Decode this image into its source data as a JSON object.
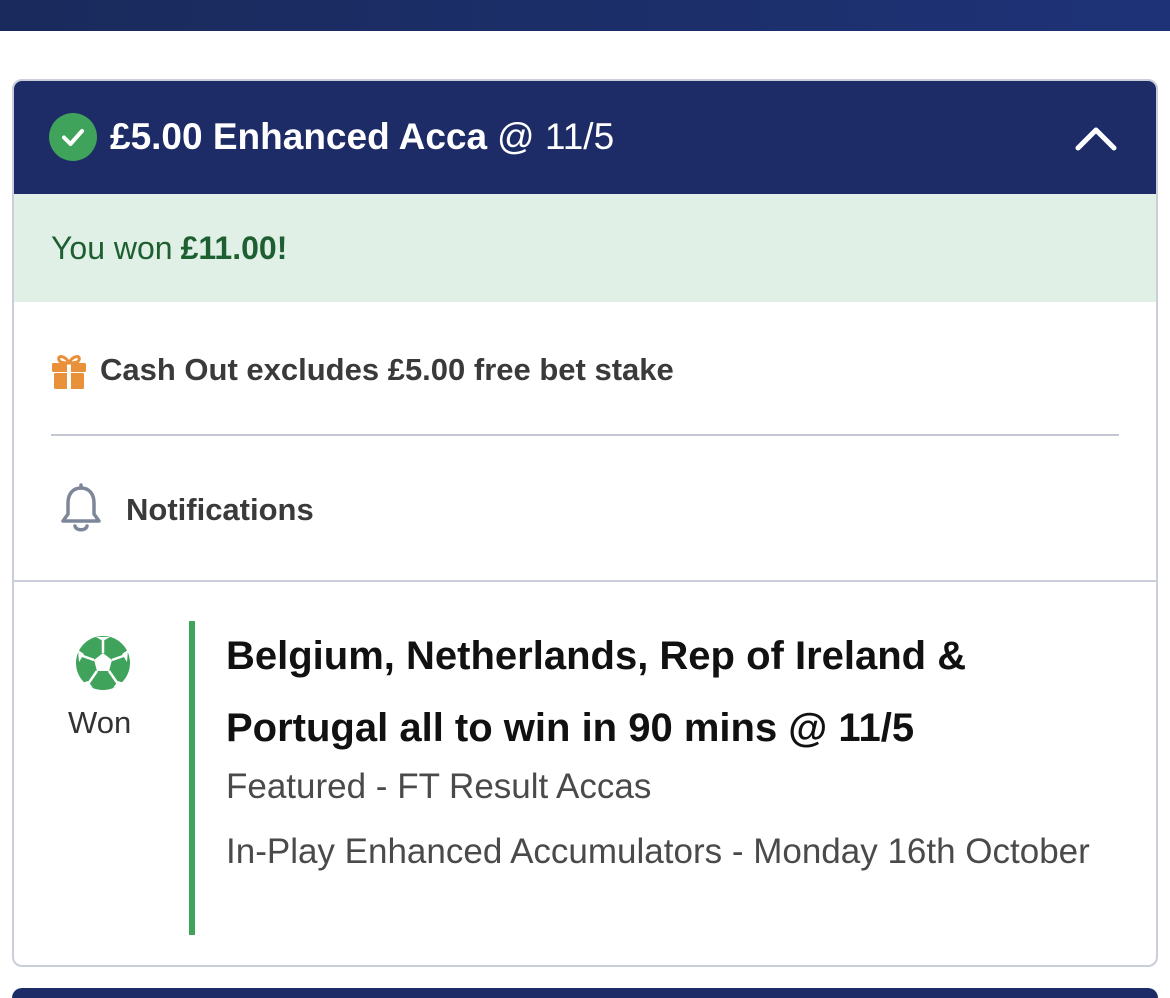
{
  "header": {
    "stake_type": "£5.00 Enhanced Acca",
    "odds": "@ 11/5",
    "collapse_icon": "chevron-up-icon",
    "status_icon": "check-circle-icon"
  },
  "result": {
    "prefix": "You won",
    "amount": "£11.00!"
  },
  "cashout": {
    "icon": "gift-icon",
    "text": "Cash Out excludes £5.00 free bet stake"
  },
  "notifications": {
    "icon": "bell-icon",
    "label": "Notifications"
  },
  "selection": {
    "sport_icon": "football-icon",
    "status": "Won",
    "title": "Belgium, Netherlands, Rep of Ireland & Portugal all to win in 90 mins @ 11/5",
    "market": "Featured - FT Result Accas",
    "event": "In-Play Enhanced Accumulators - Monday 16th October"
  },
  "colors": {
    "header_bg": "#1d2c66",
    "won_green": "#3fa35b",
    "won_banner_bg": "#e0f0e6",
    "won_text": "#1e5f31",
    "gift_orange": "#e8913a"
  }
}
